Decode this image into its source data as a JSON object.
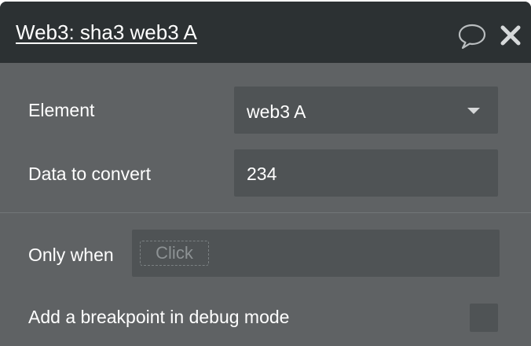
{
  "header": {
    "title": "Web3: sha3 web3 A",
    "comment_icon": "speech-bubble-icon",
    "close_icon": "close-icon"
  },
  "fields": {
    "element": {
      "label": "Element",
      "value": "web3 A"
    },
    "data_to_convert": {
      "label": "Data to convert",
      "value": "234"
    }
  },
  "condition": {
    "label": "Only when",
    "placeholder": "Click"
  },
  "breakpoint": {
    "label": "Add a breakpoint in debug mode",
    "checked": false
  },
  "colors": {
    "header_bg": "#2c3133",
    "panel_bg": "#5f6264",
    "field_bg": "#4f5355"
  }
}
